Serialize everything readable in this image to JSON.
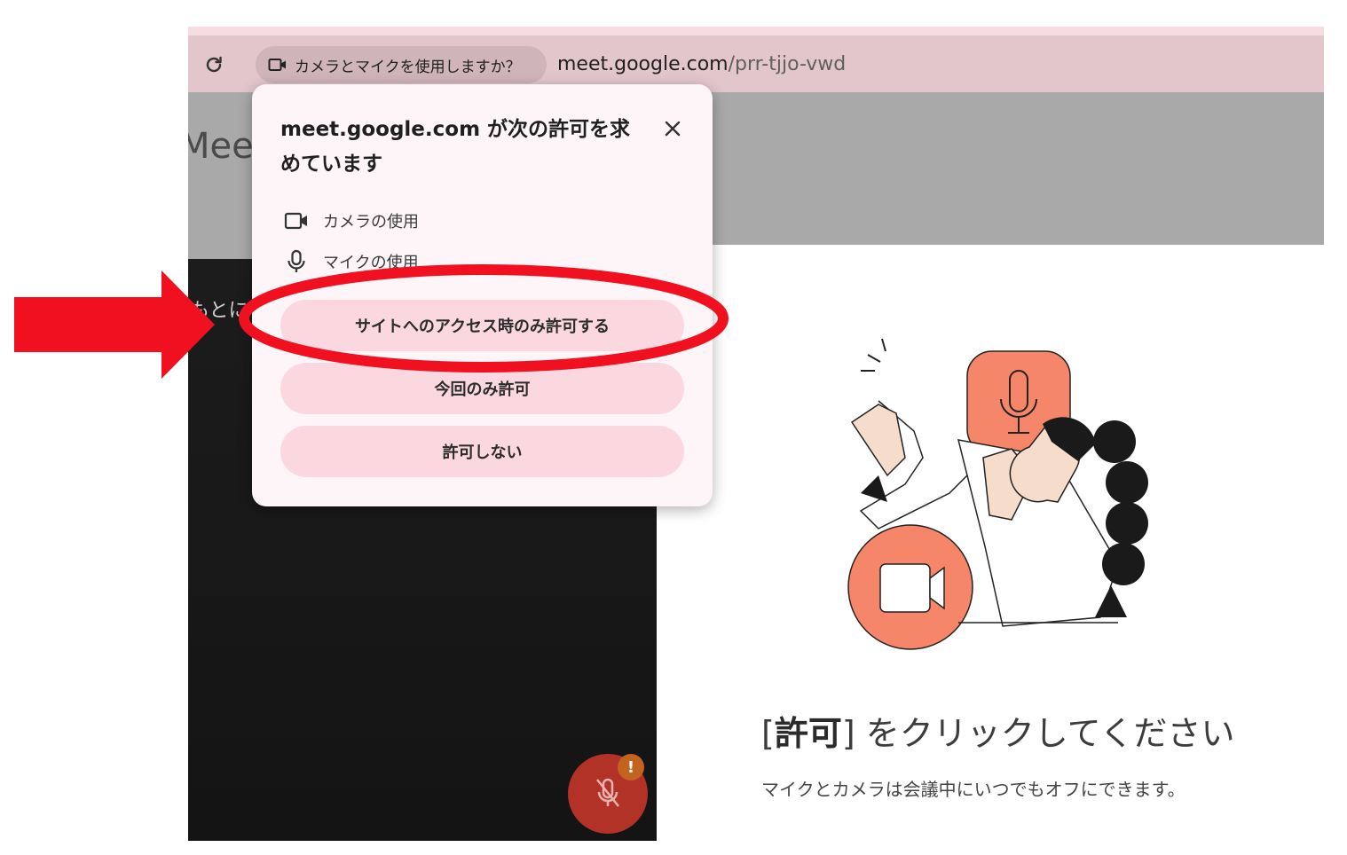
{
  "toolbar": {
    "permission_chip": "カメラとマイクを使用しますか？",
    "url_host": "meet.google.com",
    "url_path": "/prr-tjjo-vwd"
  },
  "background": {
    "app_name_partial": "Meet",
    "video_text_partial": "もとに"
  },
  "popup": {
    "title": "meet.google.com が次の許可を求めています",
    "permissions": [
      {
        "icon": "camera-icon",
        "label": "カメラの使用"
      },
      {
        "icon": "microphone-icon",
        "label": "マイクの使用"
      }
    ],
    "buttons": {
      "allow_while_visiting": "サイトへのアクセス時のみ許可する",
      "allow_this_time": "今回のみ許可",
      "never_allow": "許可しない"
    }
  },
  "card": {
    "headline_bracket_open": "[",
    "headline_bold": "許可",
    "headline_rest": "] をクリックしてください",
    "subtext": "マイクとカメラは会議中にいつでもオフにできます。"
  },
  "badge": {
    "text": "!"
  },
  "colors": {
    "annotation_red": "#f01020",
    "mic_button": "#b23228",
    "illustration_orange": "#f6866a",
    "popup_button": "#fbd8e0"
  }
}
